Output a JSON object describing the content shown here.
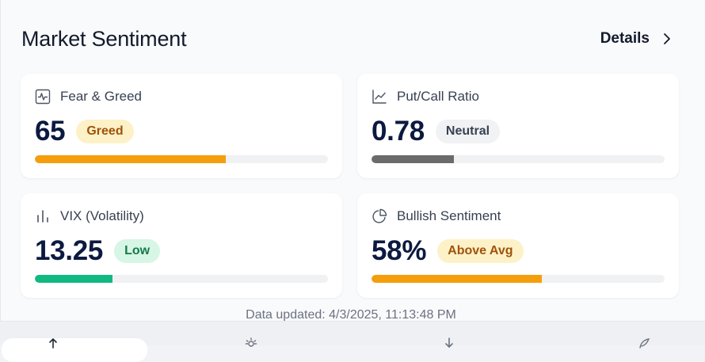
{
  "panel": {
    "title": "Market Sentiment",
    "details_label": "Details"
  },
  "cards": [
    {
      "label": "Fear & Greed",
      "icon": "activity-chart-icon",
      "value": "65",
      "badge": "Greed",
      "badge_bg": "#fdf1c7",
      "badge_color": "#a0520b",
      "progress": 0.65,
      "bar_color": "#f59e0b"
    },
    {
      "label": "Put/Call Ratio",
      "icon": "line-chart-icon",
      "value": "0.78",
      "badge": "Neutral",
      "badge_bg": "#f1f2f4",
      "badge_color": "#374151",
      "progress": 0.28,
      "bar_color": "#6b6b6b"
    },
    {
      "label": "VIX (Volatility)",
      "icon": "bar-chart-icon",
      "value": "13.25",
      "badge": "Low",
      "badge_bg": "#d7f6e5",
      "badge_color": "#17794a",
      "progress": 0.265,
      "bar_color": "#10b981"
    },
    {
      "label": "Bullish Sentiment",
      "icon": "pie-chart-icon",
      "value": "58%",
      "badge": "Above Avg",
      "badge_bg": "#fdf1c7",
      "badge_color": "#a0520b",
      "progress": 0.58,
      "bar_color": "#f59e0b"
    }
  ],
  "footer": {
    "updated_text": "Data updated: 4/3/2025, 11:13:48 PM"
  },
  "bottom_nav": {
    "icons": [
      "arrow-up-icon",
      "sun-icon",
      "arrow-down-icon",
      "leaf-icon"
    ]
  }
}
